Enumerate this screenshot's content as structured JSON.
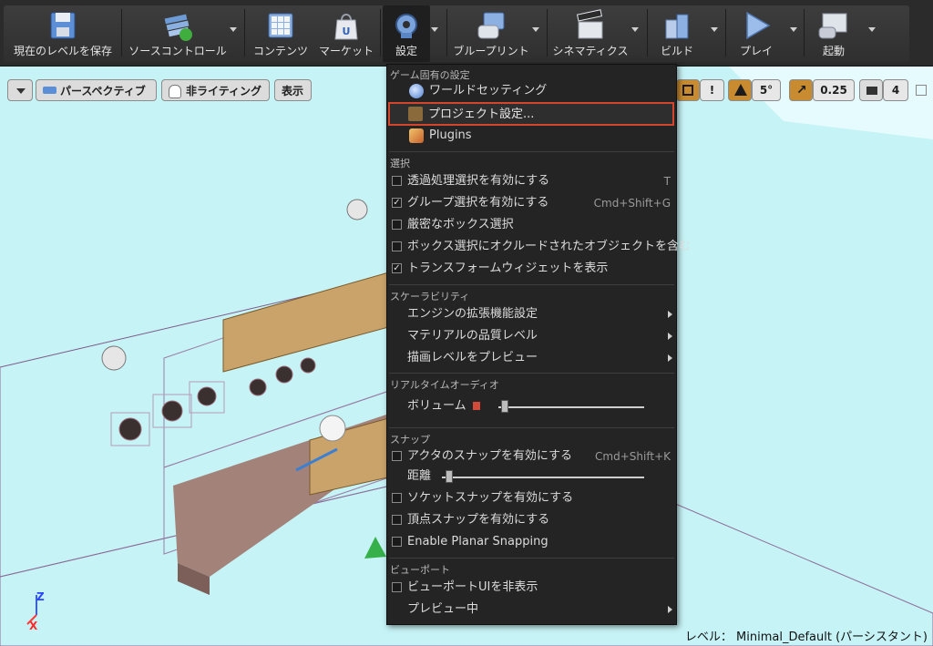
{
  "toolbar": {
    "save": "現在のレベルを保存",
    "source_control": "ソースコントロール",
    "content": "コンテンツ",
    "market": "マーケット",
    "settings": "設定",
    "blueprint": "ブループリント",
    "cinematics": "シネマティクス",
    "build": "ビルド",
    "play": "プレイ",
    "launch": "起動"
  },
  "viewport": {
    "perspective": "パースペクティブ",
    "lighting": "非ライティング",
    "show": "表示",
    "grid_snap": "!",
    "rotation_snap": "5°",
    "scale_snap": "0.25",
    "camera_speed": "4",
    "level_label": "レベル： Minimal_Default (パーシスタント)",
    "axis_z": "Z",
    "axis_x": "X"
  },
  "menu": {
    "game_specific": {
      "header": "ゲーム固有の設定",
      "world_settings": "ワールドセッティング",
      "project_settings": "プロジェクト設定...",
      "plugins": "Plugins"
    },
    "selection": {
      "header": "選択",
      "items": [
        {
          "label": "透過処理選択を有効にする",
          "shortcut": "T",
          "checked": false
        },
        {
          "label": "グループ選択を有効にする",
          "shortcut": "Cmd+Shift+G",
          "checked": true
        },
        {
          "label": "厳密なボックス選択",
          "shortcut": "",
          "checked": false
        },
        {
          "label": "ボックス選択にオクルードされたオブジェクトを含む",
          "shortcut": "",
          "checked": false
        },
        {
          "label": "トランスフォームウィジェットを表示",
          "shortcut": "",
          "checked": true
        }
      ]
    },
    "scalability": {
      "header": "スケーラビリティ",
      "items": [
        "エンジンの拡張機能設定",
        "マテリアルの品質レベル",
        "描画レベルをプレビュー"
      ]
    },
    "audio": {
      "header": "リアルタイムオーディオ",
      "volume": "ボリューム",
      "volume_level": 0.02
    },
    "snap": {
      "header": "スナップ",
      "actor_snap": "アクタのスナップを有効にする",
      "actor_snap_shortcut": "Cmd+Shift+K",
      "distance": "距離",
      "distance_level": 0.02,
      "socket_snap": "ソケットスナップを有効にする",
      "vertex_snap": "頂点スナップを有効にする",
      "planar_snap": "Enable Planar Snapping"
    },
    "viewport_section": {
      "header": "ビューポート",
      "hide_ui": "ビューポートUIを非表示",
      "preview": "プレビュー中"
    }
  },
  "colors": {
    "highlight_border": "#d2462d",
    "menu_bg": "#242424",
    "sky": "#c5f3f6"
  }
}
